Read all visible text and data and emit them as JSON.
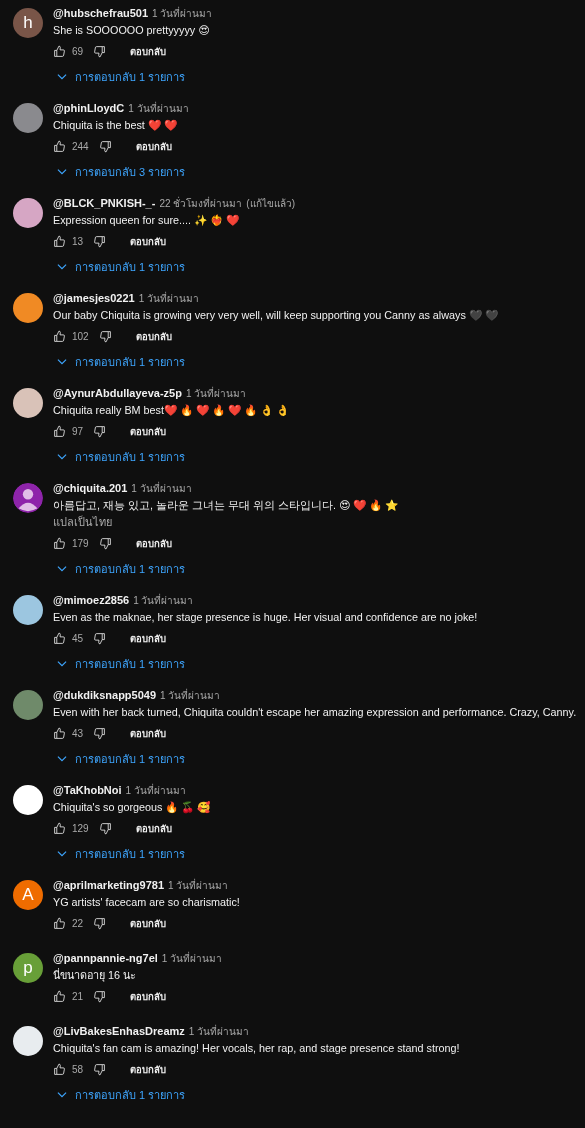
{
  "comments": [
    {
      "avatar": {
        "kind": "letter",
        "letter": "h",
        "color": "#795548"
      },
      "author": "@hubschefrau501",
      "time": "1 วันที่ผ่านมา",
      "text": "She is SOOOOOO prettyyyyy 😍",
      "likes": "69",
      "reply": "ตอบกลับ",
      "replies": "การตอบกลับ 1 รายการ"
    },
    {
      "avatar": {
        "kind": "photo",
        "color": "#8a8a8e"
      },
      "author": "@phinLloydC",
      "time": "1 วันที่ผ่านมา",
      "text": "Chiquita is the best ❤️ ❤️",
      "likes": "244",
      "reply": "ตอบกลับ",
      "replies": "การตอบกลับ 3 รายการ"
    },
    {
      "avatar": {
        "kind": "photo",
        "color": "#d6a6c4"
      },
      "author": "@BLCK_PNKISH-_-",
      "time": "22 ชั่วโมงที่ผ่านมา",
      "edited": "(แก้ไขแล้ว)",
      "text": "Expression queen for sure.... ✨ ❤️‍🔥 ❤️",
      "likes": "13",
      "reply": "ตอบกลับ",
      "replies": "การตอบกลับ 1 รายการ"
    },
    {
      "avatar": {
        "kind": "photo",
        "color": "#f08a24"
      },
      "author": "@jamesjes0221",
      "time": "1 วันที่ผ่านมา",
      "text": "Our baby Chiquita is growing very very well, will keep supporting you Canny as always 🖤 🖤",
      "likes": "102",
      "reply": "ตอบกลับ",
      "replies": "การตอบกลับ 1 รายการ"
    },
    {
      "avatar": {
        "kind": "photo",
        "color": "#d9c2b8"
      },
      "author": "@AynurAbdullayeva-z5p",
      "time": "1 วันที่ผ่านมา",
      "text": "Chiquita really BM best❤️ 🔥 ❤️ 🔥 ❤️ 🔥 👌 👌",
      "likes": "97",
      "reply": "ตอบกลับ",
      "replies": "การตอบกลับ 1 รายการ"
    },
    {
      "avatar": {
        "kind": "silhouette",
        "color": "#8e24aa"
      },
      "author": "@chiquita.201",
      "time": "1 วันที่ผ่านมา",
      "text": "아름답고, 재능 있고, 놀라운 그녀는 무대 위의 스타입니다. 😍 ❤️ 🔥 ⭐",
      "translate": "แปลเป็นไทย",
      "likes": "179",
      "reply": "ตอบกลับ",
      "replies": "การตอบกลับ 1 รายการ"
    },
    {
      "avatar": {
        "kind": "photo",
        "color": "#9cc6e0"
      },
      "author": "@mimoez2856",
      "time": "1 วันที่ผ่านมา",
      "text": "Even as the maknae, her stage presence is huge. Her visual and confidence are no joke!",
      "likes": "45",
      "reply": "ตอบกลับ",
      "replies": "การตอบกลับ 1 รายการ"
    },
    {
      "avatar": {
        "kind": "photo",
        "color": "#6f8a6a"
      },
      "author": "@dukdiksnapp5049",
      "time": "1 วันที่ผ่านมา",
      "text": "Even with her back turned, Chiquita couldn't escape her amazing expression and performance. Crazy, Canny.",
      "likes": "43",
      "reply": "ตอบกลับ",
      "replies": "การตอบกลับ 1 รายการ"
    },
    {
      "avatar": {
        "kind": "photo",
        "color": "#ffffff"
      },
      "author": "@TaKhobNoi",
      "time": "1 วันที่ผ่านมา",
      "text": "Chiquita's so gorgeous 🔥 🍒 🥰",
      "likes": "129",
      "reply": "ตอบกลับ",
      "replies": "การตอบกลับ 1 รายการ"
    },
    {
      "avatar": {
        "kind": "letter",
        "letter": "A",
        "color": "#ef6c00"
      },
      "author": "@aprilmarketing9781",
      "time": "1 วันที่ผ่านมา",
      "text": "YG artists' facecam are so charismatic!",
      "likes": "22",
      "reply": "ตอบกลับ"
    },
    {
      "avatar": {
        "kind": "letter",
        "letter": "p",
        "color": "#689f38"
      },
      "author": "@pannpannie-ng7el",
      "time": "1 วันที่ผ่านมา",
      "text": "นี่ขนาดอายุ 16 นะ",
      "likes": "21",
      "reply": "ตอบกลับ"
    },
    {
      "avatar": {
        "kind": "photo",
        "color": "#e8ecef"
      },
      "author": "@LivBakesEnhasDreamz",
      "time": "1 วันที่ผ่านมา",
      "text": "Chiquita's fan cam is amazing! Her vocals, her rap, and stage presence stand strong!",
      "likes": "58",
      "reply": "ตอบกลับ",
      "replies": "การตอบกลับ 1 รายการ"
    }
  ]
}
